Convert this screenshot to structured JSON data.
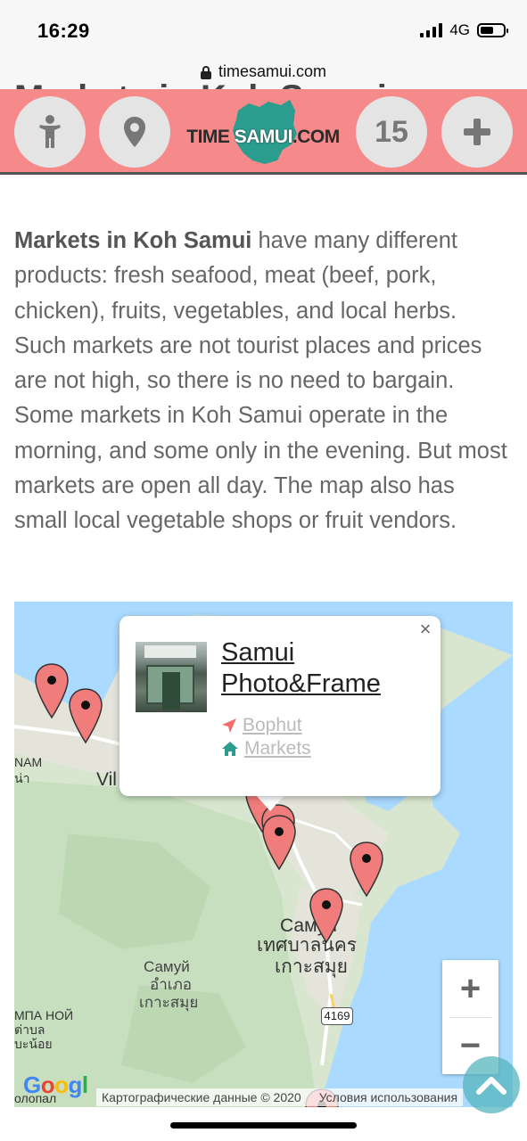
{
  "status_bar": {
    "time": "16:29",
    "network": "4G",
    "battery_level": 0.6
  },
  "browser": {
    "url": "timesamui.com"
  },
  "header": {
    "behind_heading": "Markets in Koh Samui",
    "logo_left": "TIME ",
    "logo_mid": "SAMUI",
    "logo_right": ".COM",
    "count": "15",
    "icons": [
      "person-icon",
      "location-pin-icon",
      "plus-icon"
    ],
    "background_color": "#f68a8a"
  },
  "article": {
    "lead_bold": "Markets in Koh Samui",
    "body": " have many different products: fresh seafood, meat (beef, pork, chicken), fruits, vegetables, and local herbs. Such markets are not tourist places and prices are not high, so there is no need to bargain. Some markets in Koh Samui oper­ate in the morning, and some only in the evening. But most markets are open all day. The map also has small local vegetable shops or fruit vendors."
  },
  "map": {
    "labels": {
      "nam": "NAM",
      "nam_thai": "น่า",
      "vil": "Vil",
      "samui_city": "Самуи",
      "samui_city_thai_1": "เทศบาลนคร",
      "samui_city_thai_2": "เกาะสมุย",
      "samui_district": "Самуй",
      "samui_district_thai_1": "อำเภอ",
      "samui_district_thai_2": "เกาะสมุย",
      "na_noi": "МПА НОЙ",
      "na_noi_thai_1": "ต่าบล",
      "na_noi_thai_2": "บะน้อย",
      "road": "4169",
      "google_bottom": "олопал"
    },
    "zoom_in": "+",
    "zoom_out": "−",
    "google_logo": [
      "G",
      "o",
      "o",
      "g",
      "l"
    ],
    "attribution": {
      "map_data": "Картографические данные © 2020",
      "terms": "Условия использования"
    },
    "pin_color": "#f07c7c",
    "info_window": {
      "title": "Samui Photo&Frame",
      "location": "Bophut",
      "category": "Markets",
      "close": "×",
      "location_icon_color": "#f26d6d",
      "category_icon_color": "#2a9d8f"
    }
  }
}
